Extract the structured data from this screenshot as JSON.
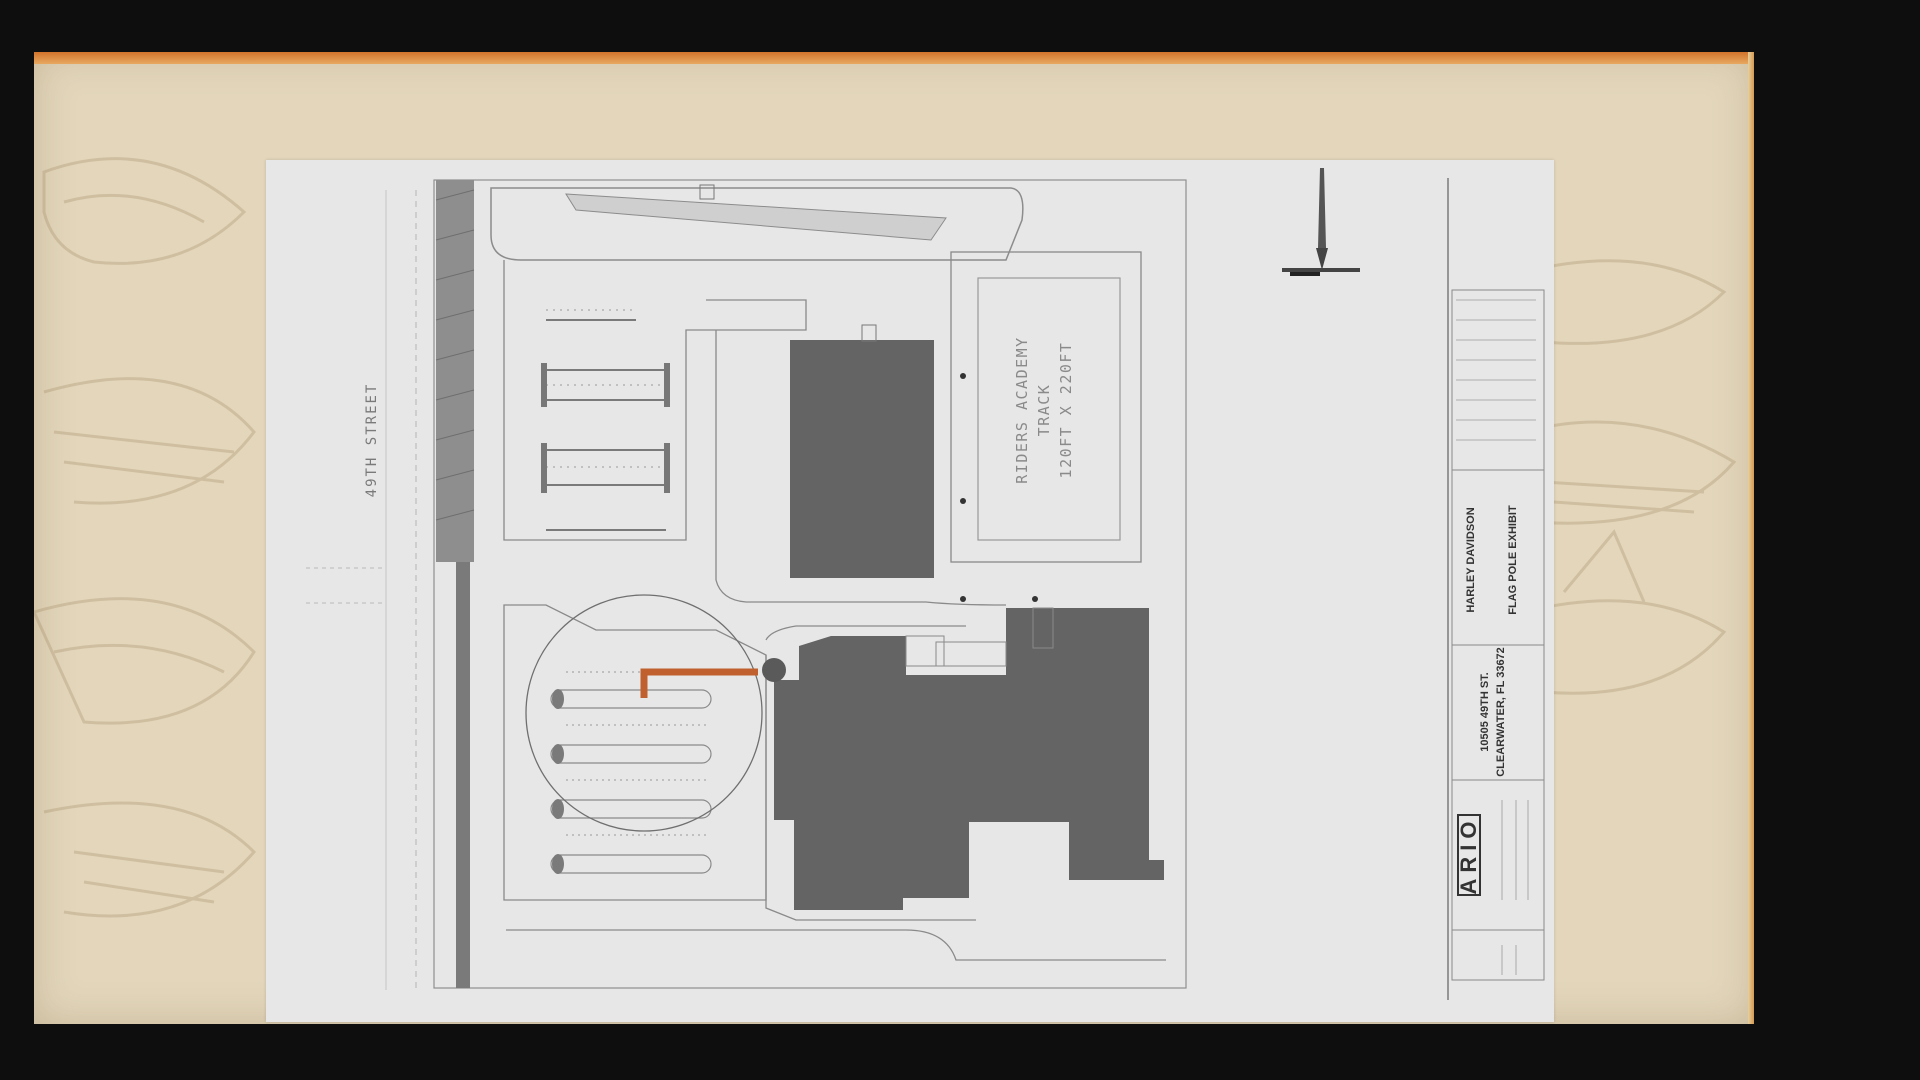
{
  "street_label": "49TH STREET",
  "track": {
    "line1": "RIDERS ACADEMY",
    "line2": "TRACK",
    "line3": "120FT X 220FT"
  },
  "title_block": {
    "company": "HARLEY DAVIDSON",
    "project": "FLAG POLE EXHIBIT",
    "address_line1": "10505 49TH ST.",
    "address_line2": "CLEARWATER, FL 33672",
    "logo": "ARIO"
  },
  "colors": {
    "slide_background": "#e3d6bb",
    "accent_bar": "#d1732b",
    "building_fill": "#646464",
    "highlight_path": "#c0602e",
    "flag_pole_marker": "#5a5a5a",
    "sheet_background": "#e6e7e6"
  }
}
